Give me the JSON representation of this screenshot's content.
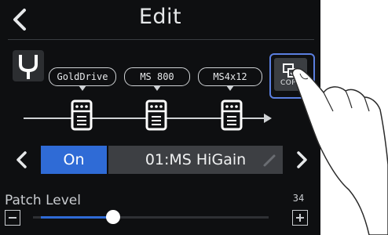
{
  "header": {
    "title": "Edit",
    "back_icon": "chevron-left-icon"
  },
  "chain": {
    "tuner_icon": "tuning-fork-icon",
    "effects": [
      {
        "name": "GoldDrive"
      },
      {
        "name": "MS 800"
      },
      {
        "name": "MS4x12"
      }
    ],
    "copy_label": "COPY"
  },
  "patch": {
    "state": "On",
    "name": "01:MS HiGain",
    "accent": "#2f6bd6"
  },
  "level": {
    "label": "Patch Level",
    "value": "34",
    "fraction": 0.34
  }
}
